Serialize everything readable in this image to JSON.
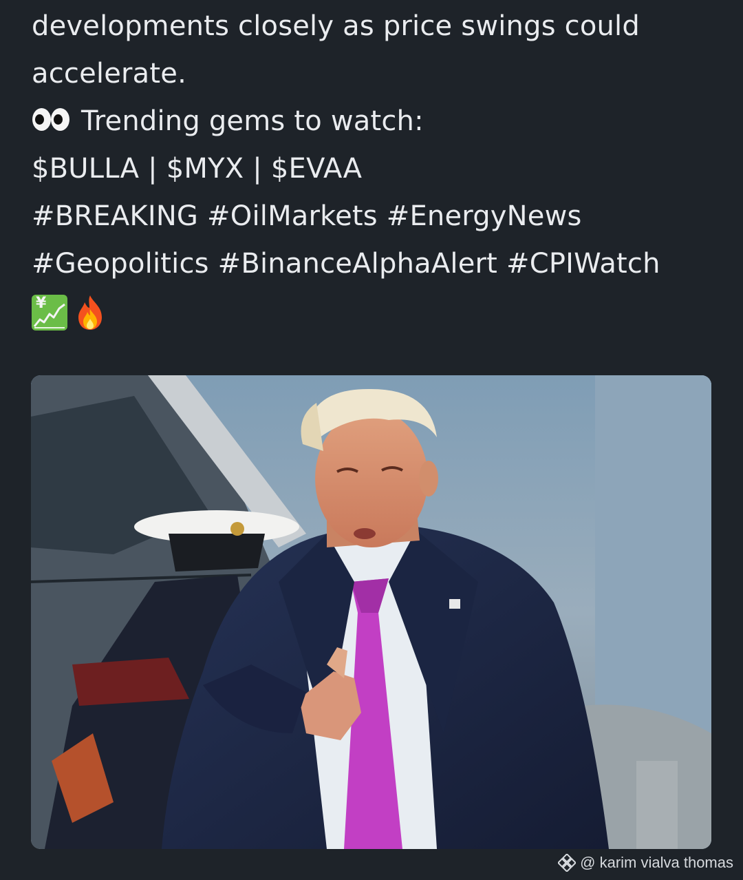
{
  "post": {
    "lines": [
      "developments closely as price swings could",
      "accelerate.",
      "Trending gems to watch:",
      "$BULLA | $MYX | $EVAA",
      "#BREAKING #OilMarkets #EnergyNews",
      "#Geopolitics #BinanceAlphaAlert #CPIWatch"
    ],
    "eyes_icon": "eyes-emoji",
    "trailing_emojis": [
      "chart-increasing-with-yen-emoji",
      "fire-emoji"
    ],
    "chart_emoji_glyph": "¥"
  },
  "image": {
    "subject": "news-photo"
  },
  "watermark": {
    "icon": "binance-logo-icon",
    "text": "@ karim vialva thomas"
  },
  "colors": {
    "background": "#1e2329",
    "text": "#eaecef",
    "chart_emoji_green": "#6bbd47",
    "tie_magenta": "#c23fc4"
  }
}
